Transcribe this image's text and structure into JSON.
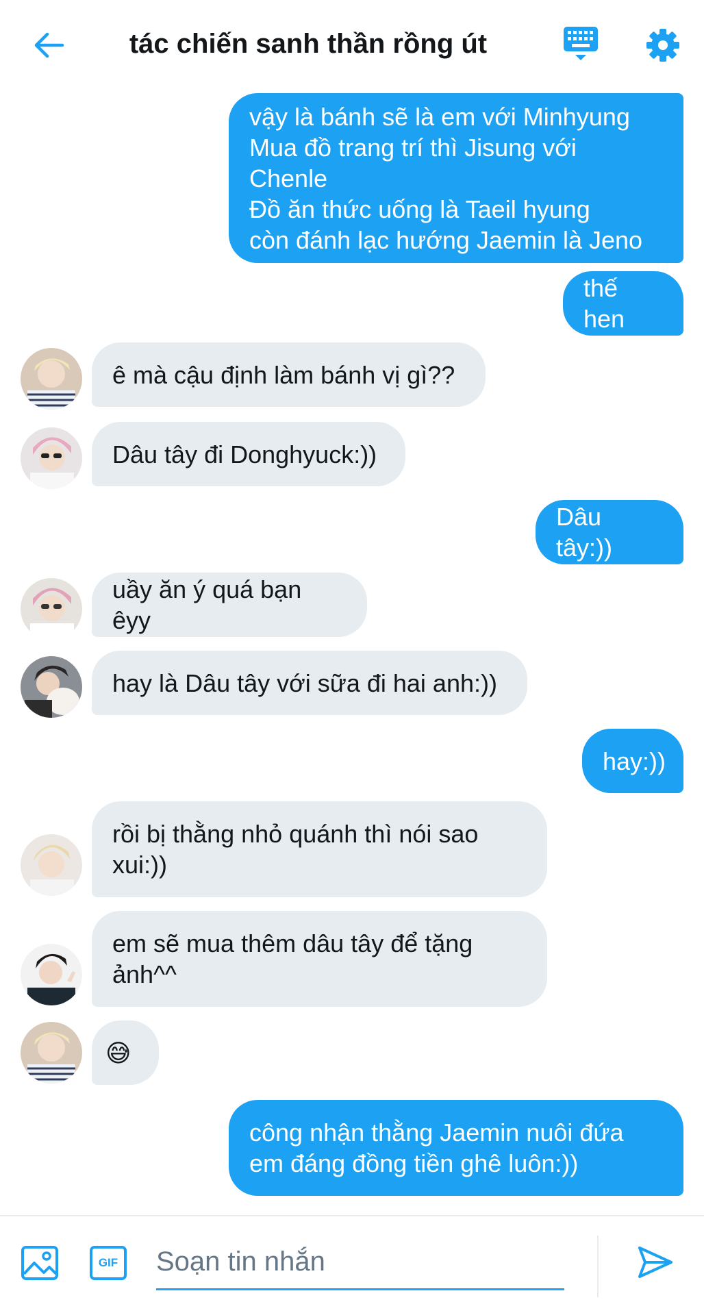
{
  "header": {
    "title": "tác chiến sanh thần rồng út",
    "back_icon": "arrow-left-icon",
    "keyboard_icon": "keyboard-icon",
    "settings_icon": "gear-icon"
  },
  "colors": {
    "accent": "#1da1f2",
    "incoming_bubble": "#e6ecf0",
    "text": "#14171a",
    "placeholder": "#657786"
  },
  "messages": [
    {
      "direction": "out",
      "text": "vậy là bánh sẽ là em với Minhyung\nMua đồ trang trí thì Jisung với\nChenle\nĐồ ăn thức uống là Taeil hyung\ncòn đánh lạc hướng Jaemin là Jeno"
    },
    {
      "direction": "out",
      "text": "thế hen"
    },
    {
      "direction": "in",
      "text": "ê mà cậu định làm bánh vị gì??"
    },
    {
      "direction": "in",
      "text": "Dâu tây đi Donghyuck:))"
    },
    {
      "direction": "out",
      "text": "Dâu tây:))"
    },
    {
      "direction": "in",
      "text": "uầy ăn ý quá bạn êyy"
    },
    {
      "direction": "in",
      "text": "hay là Dâu tây với sữa đi hai anh:))"
    },
    {
      "direction": "out",
      "text": "hay:))"
    },
    {
      "direction": "in",
      "text": "rồi bị thằng nhỏ quánh thì nói sao\nxui:))"
    },
    {
      "direction": "in",
      "text": "em sẽ mua thêm dâu tây để tặng\nảnh^^"
    },
    {
      "direction": "in",
      "text": "😅"
    },
    {
      "direction": "out",
      "text": "công nhận thằng Jaemin nuôi đứa\nem đáng đồng tiền ghê luôn:))"
    }
  ],
  "composer": {
    "placeholder": "Soạn tin nhắn",
    "value": "",
    "image_icon": "image-icon",
    "gif_label": "GIF",
    "send_icon": "send-icon"
  }
}
